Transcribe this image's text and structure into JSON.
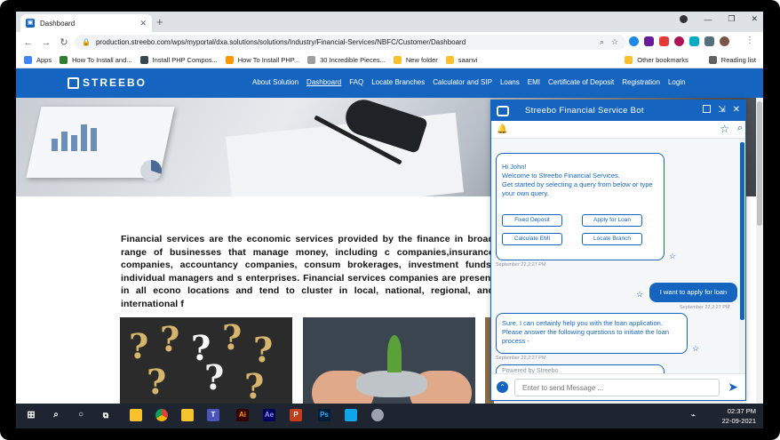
{
  "browser": {
    "tab_title": "Dashboard",
    "new_tab": "+",
    "url": "production.streebo.com/wps/myportal/dxa.solutions/solutions/Industry/Financial-Services/NBFC/Customer/Dashboard",
    "bookmarks": [
      {
        "label": "Apps",
        "color": "#4285f4"
      },
      {
        "label": "How To Install and...",
        "color": "#2e7d32"
      },
      {
        "label": "Install PHP Compos...",
        "color": "#37474f"
      },
      {
        "label": "How To Install PHP...",
        "color": "#ff9800"
      },
      {
        "label": "30 Incredible Pieces...",
        "color": "#9e9e9e"
      },
      {
        "label": "New folder",
        "color": "#fbc02d"
      },
      {
        "label": "saanvi",
        "color": "#fbc02d"
      }
    ],
    "bookmarks_right": [
      "Other bookmarks",
      "Reading list"
    ]
  },
  "site": {
    "logo": "STREEBO",
    "menu": [
      "About Solution",
      "Dashboard",
      "FAQ",
      "Locate Branches",
      "Calculator and SIP",
      "Loans",
      "EMI",
      "Certificate of Deposit",
      "Registration",
      "Login"
    ],
    "active_menu": "Dashboard",
    "paragraph": "Financial services are the economic services provided by the finance in broad range of businesses that manage money, including c companies,insurance companies, accountancy companies, consum brokerages, investment funds, individual managers and s enterprises. Financial services companies are present in all econo locations and tend to cluster in local, national, regional, and international f"
  },
  "chatbot": {
    "title": "Streebo Financial Service Bot",
    "welcome": "Hi John!\nWelcome to Streebo Financial Services.\nGet started by selecting a query from below or type your own query.",
    "quick_replies": [
      "Fixed Deposit",
      "Apply for Loan",
      "Calculate EMI",
      "Locate Branch"
    ],
    "ts1": "September 22,2:27 PM",
    "user_msg": "I want to apply for loan",
    "ts2": "September 22,2:27 PM",
    "bot_reply": "Sure, I can certainly help you with the loan application. Please answer the following questions to initiate the loan process -",
    "ts3": "September 22,2:27 PM",
    "powered": "Powered by Streebo",
    "input_placeholder": "Enter to send Message ..."
  },
  "taskbar": {
    "time": "02:37 PM",
    "date": "22-09-2021"
  }
}
